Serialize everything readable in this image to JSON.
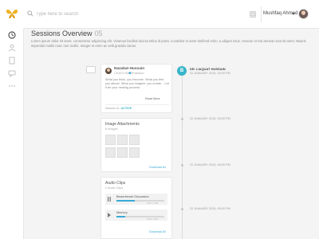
{
  "search": {
    "placeholder": "Type here to search"
  },
  "user": {
    "name": "Mushfaq Ahmed"
  },
  "page": {
    "title": "Sessions Overview",
    "count": "05",
    "description": "Lorem ipsum dolor sit amet, consectetur adipiscing elit. Vivamus facilisis lacinia tellus id porta. Curabitur et amet eleifend enim, a aliquet risus. Aenean et nisi aenean erat sit amet. Mauris imperdiet mollis nunc non mollis. Integer et enim ac velit gravida varius."
  },
  "session_card": {
    "name": "Nazakat Hussain",
    "role": "CHAT/VIDEO",
    "location": "Pakistan",
    "message": "What you think, you become. What you feel, you attract. What you imagine, you create. - Let it be your healing process",
    "read_more": "Read More",
    "status_label": "Session Id :",
    "status_value": "ACTIVE"
  },
  "images_card": {
    "title": "Image Attachments",
    "count": "6 Images",
    "download": "Download All"
  },
  "audio_card": {
    "title": "Audio Clips",
    "count": "2 Audio Clips",
    "clips": [
      {
        "label": "Bewerbende Discussion",
        "progress": 0.38,
        "duration": "0:47 / 1:24"
      },
      {
        "label": "Memory",
        "progress": 0.18,
        "duration": "0:20 / 1:57"
      }
    ],
    "download": "Download All"
  },
  "timeline": {
    "badge": "B",
    "entries": [
      {
        "name": "DR. LIAQUAT HUSSAIN",
        "date": "22 JANUARY 2015, 05:00 PM"
      },
      {
        "date": "22 JANUARY 2015, 05:00 PM"
      },
      {
        "date": "22 JANUARY 2015, 05:00 PM"
      },
      {
        "date": "22 JANUARY 2015, 05:00 PM"
      }
    ]
  },
  "colors": {
    "accent": "#3aaad6",
    "teal": "#39b6c9",
    "brand": "#f0b020",
    "page_bg": "#f4f4f4"
  },
  "icons": [
    "butterfly-logo-icon",
    "search-icon",
    "grid-icon",
    "caret-down-icon",
    "clock-icon",
    "user-icon",
    "document-icon",
    "chat-icon",
    "more-icon",
    "image-icon",
    "audio-icon",
    "play-icon"
  ]
}
